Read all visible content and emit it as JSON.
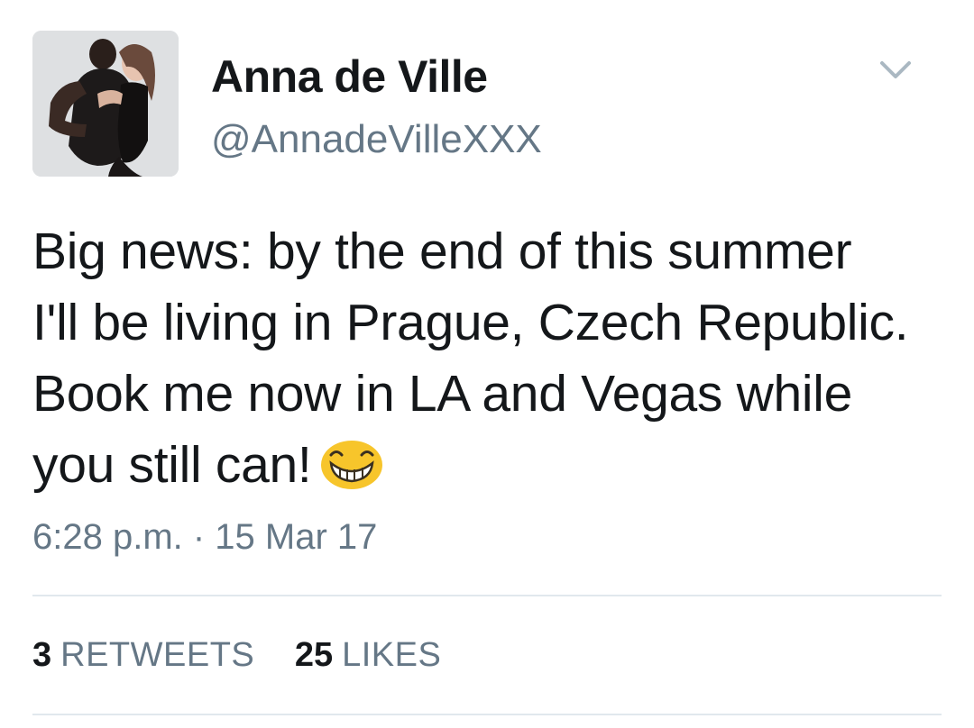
{
  "user": {
    "display_name": "Anna de Ville",
    "handle": "@AnnadeVilleXXX",
    "avatar_icon": "profile-photo"
  },
  "menu_icon": "chevron-down-icon",
  "tweet": {
    "lines": [
      "Big news: by the end of this summer",
      "I'll be living in Prague, Czech Republic.",
      "Book me now in LA and Vegas while",
      "you still can!"
    ],
    "emoji": "grinning-face-with-smiling-eyes"
  },
  "timestamp": "6:28 p.m. · 15 Mar 17",
  "stats": {
    "retweets_count": "3",
    "retweets_label": "RETWEETS",
    "likes_count": "25",
    "likes_label": "LIKES"
  },
  "colors": {
    "text_primary": "#14171a",
    "text_secondary": "#657786",
    "divider": "#e1e8ed",
    "emoji_yellow": "#f7c52b"
  }
}
